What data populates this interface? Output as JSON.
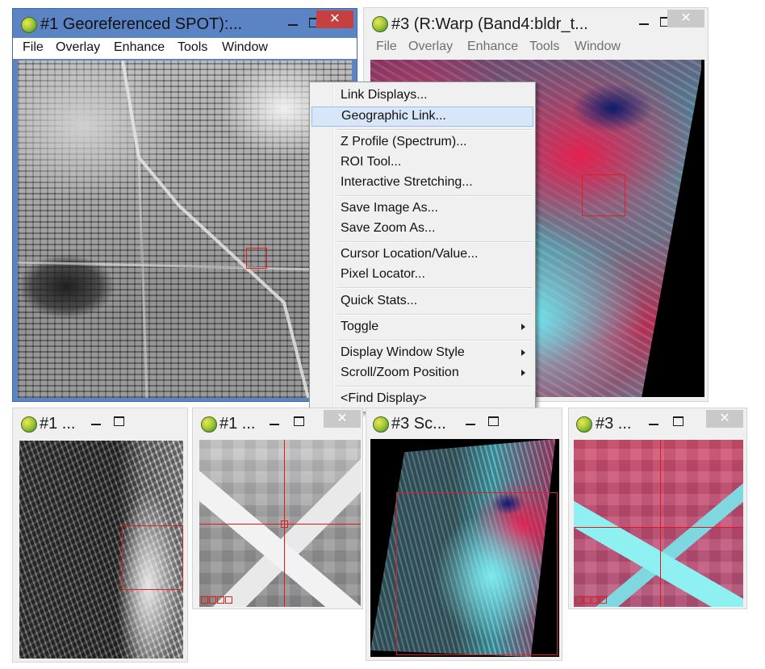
{
  "windows": {
    "w1_main": {
      "title": "#1 Georeferenced SPOT):..."
    },
    "w3_main": {
      "title": "#3 (R:Warp (Band4:bldr_t..."
    },
    "w1_scroll": {
      "title": "#1 ..."
    },
    "w1_zoom": {
      "title": "#1 ..."
    },
    "w3_scroll": {
      "title": "#3 Sc..."
    },
    "w3_zoom": {
      "title": "#3 ..."
    }
  },
  "window_buttons": {
    "close": "✕"
  },
  "menubar": {
    "file": "File",
    "overlay": "Overlay",
    "enhance": "Enhance",
    "tools": "Tools",
    "window": "Window"
  },
  "context_menu": {
    "items": [
      {
        "label": "Link Displays..."
      },
      {
        "label": "Geographic Link..."
      },
      {
        "label": "Z Profile (Spectrum)..."
      },
      {
        "label": "ROI Tool..."
      },
      {
        "label": "Interactive Stretching..."
      },
      {
        "label": "Save Image As..."
      },
      {
        "label": "Save Zoom As..."
      },
      {
        "label": "Cursor Location/Value..."
      },
      {
        "label": "Pixel Locator..."
      },
      {
        "label": "Quick Stats..."
      },
      {
        "label": "Toggle"
      },
      {
        "label": "Display Window Style"
      },
      {
        "label": "Scroll/Zoom Position"
      },
      {
        "label": "<Find Display>"
      }
    ],
    "highlighted_index": 1
  },
  "colors": {
    "active_title_bar": "#5b84c4",
    "close_active": "#c74040",
    "menu_highlight": "#d7e6f8",
    "cursor_box": "#e02020"
  },
  "icons": [
    "globe-icon",
    "minimize-icon",
    "maximize-icon",
    "close-icon",
    "submenu-arrow-icon",
    "zoom-control-icon"
  ]
}
